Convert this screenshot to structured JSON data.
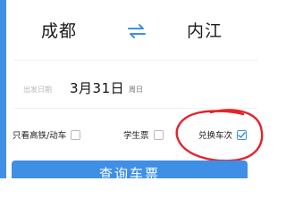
{
  "route": {
    "from_station": "成都",
    "to_station": "内江",
    "swap_icon": "swap-arrows-icon"
  },
  "date": {
    "label": "出发日期",
    "value": "3月31日",
    "weekday": "周日"
  },
  "options": {
    "gaotie_label": "只看高铁/动车",
    "gaotie_checked": false,
    "student_label": "学生票",
    "student_checked": false,
    "exchange_label": "兑换车次",
    "exchange_checked": true
  },
  "search": {
    "label": "查询车票"
  },
  "colors": {
    "accent": "#3f8fe6",
    "annotation_red": "#e3242b"
  }
}
